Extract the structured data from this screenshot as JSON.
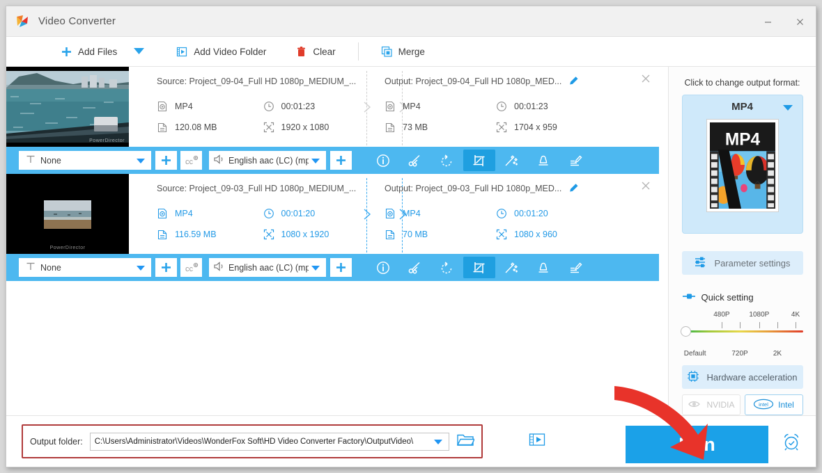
{
  "window": {
    "title": "Video Converter",
    "minimize_label": "–",
    "close_label": "✕"
  },
  "toolbar": {
    "add_files": "Add Files",
    "add_video_folder": "Add Video Folder",
    "clear": "Clear",
    "merge": "Merge"
  },
  "files": [
    {
      "selected": false,
      "thumb_watermark": "PowerDirector",
      "source": {
        "title": "Source: Project_09-04_Full HD 1080p_MEDIUM_...",
        "format": "MP4",
        "duration": "00:01:23",
        "size": "120.08 MB",
        "resolution": "1920 x 1080"
      },
      "output": {
        "title": "Output: Project_09-04_Full HD 1080p_MED...",
        "format": "MP4",
        "duration": "00:01:23",
        "size": "73 MB",
        "resolution": "1704 x 959"
      },
      "actions": {
        "subtitle_value": "None",
        "audio_value": "English aac (LC) (mp",
        "cc_label": "cc"
      }
    },
    {
      "selected": true,
      "thumb_watermark": "PowerDirector",
      "source": {
        "title": "Source: Project_09-03_Full HD 1080p_MEDIUM_...",
        "format": "MP4",
        "duration": "00:01:20",
        "size": "116.59 MB",
        "resolution": "1080 x 1920"
      },
      "output": {
        "title": "Output: Project_09-03_Full HD 1080p_MED...",
        "format": "MP4",
        "duration": "00:01:20",
        "size": "70 MB",
        "resolution": "1080 x 960"
      },
      "actions": {
        "subtitle_value": "None",
        "audio_value": "English aac (LC) (mp",
        "cc_label": "cc"
      }
    }
  ],
  "right_panel": {
    "change_format_label": "Click to change output format:",
    "format_name": "MP4",
    "format_thumb_label": "MP4",
    "parameter_settings": "Parameter settings",
    "quick_setting": "Quick setting",
    "quality_labels_top": [
      "480P",
      "1080P",
      "4K"
    ],
    "quality_labels_bottom": [
      "Default",
      "720P",
      "2K"
    ],
    "hardware_acceleration": "Hardware acceleration",
    "gpu_nvidia": "NVIDIA",
    "gpu_intel": "Intel"
  },
  "bottom": {
    "output_folder_label": "Output folder:",
    "output_folder_path": "C:\\Users\\Administrator\\Videos\\WonderFox Soft\\HD Video Converter Factory\\OutputVideo\\",
    "run_label": "Run"
  },
  "colors": {
    "accent": "#1ba1e8",
    "action_bar": "#4db8f0",
    "highlight_box": "#cfe9fa",
    "red_arrow": "#e8332a",
    "red_outline": "#b03a3a"
  }
}
